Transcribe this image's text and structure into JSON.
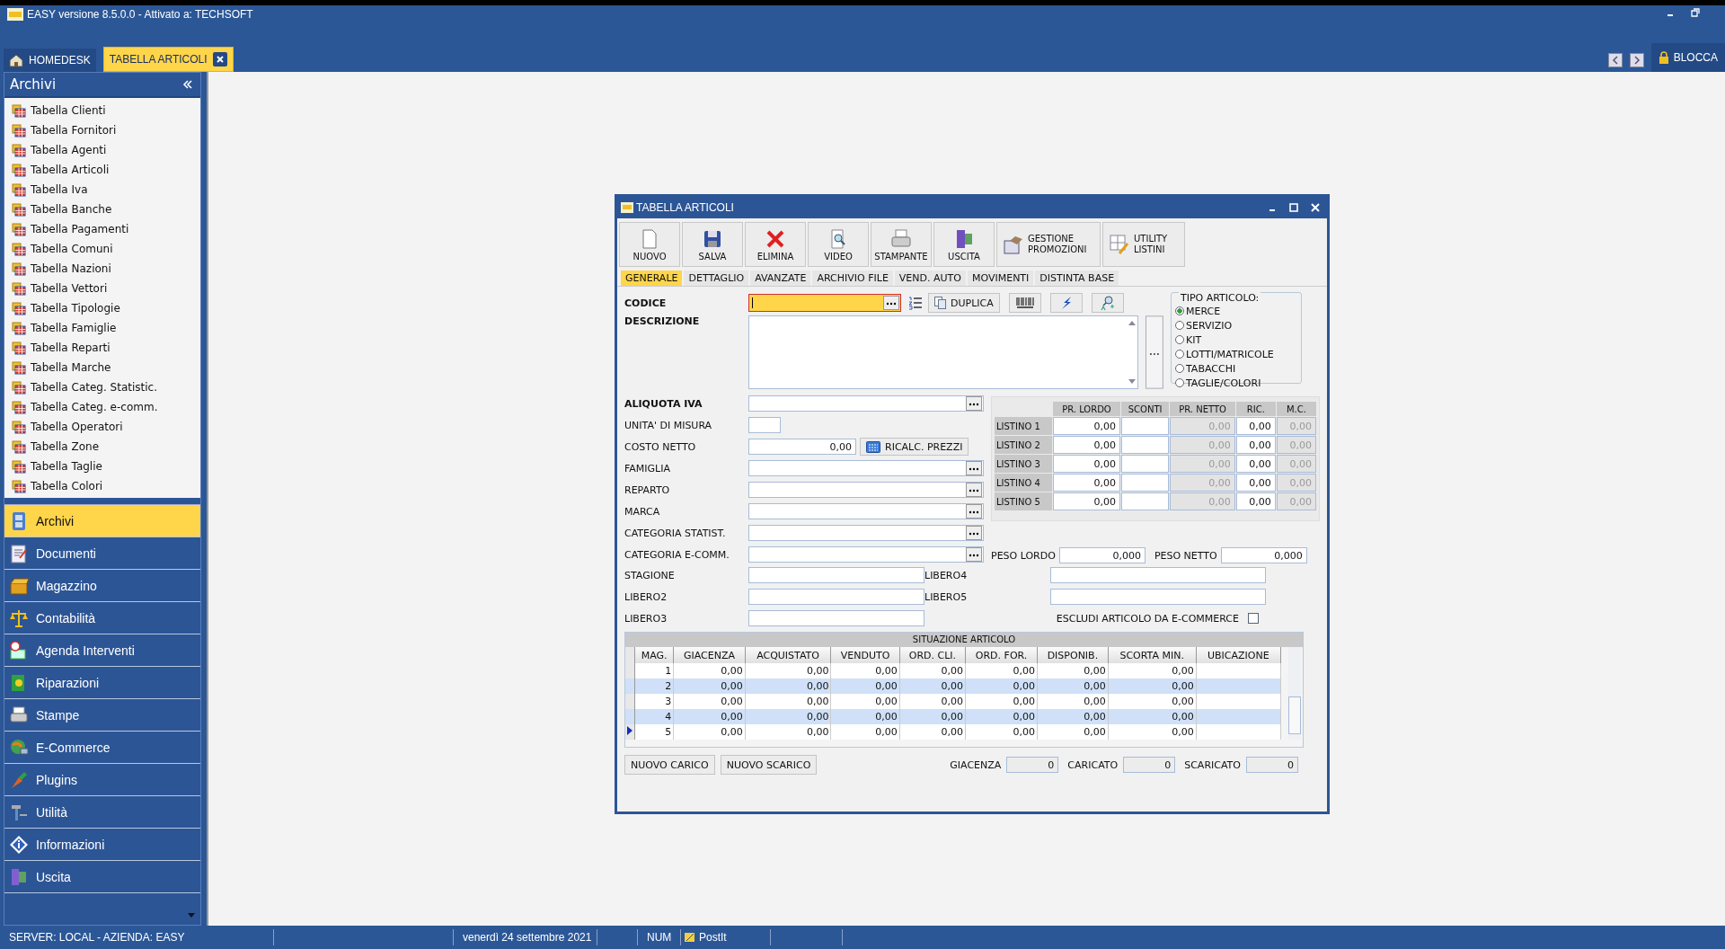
{
  "app": {
    "title": "EASY versione 8.5.0.0 - Attivato a: TECHSOFT"
  },
  "tabs": [
    {
      "label": "HOMEDESK",
      "selected": false
    },
    {
      "label": "TABELLA ARTICOLI",
      "selected": true
    }
  ],
  "lock_button": {
    "label": "BLOCCA"
  },
  "sidebar": {
    "title": "Archivi",
    "items": [
      "Tabella Clienti",
      "Tabella Fornitori",
      "Tabella Agenti",
      "Tabella Articoli",
      "Tabella Iva",
      "Tabella Banche",
      "Tabella Pagamenti",
      "Tabella Comuni",
      "Tabella Nazioni",
      "Tabella Vettori",
      "Tabella Tipologie",
      "Tabella Famiglie",
      "Tabella Reparti",
      "Tabella Marche",
      "Tabella Categ. Statistic.",
      "Tabella Categ. e-comm.",
      "Tabella Operatori",
      "Tabella Zone",
      "Tabella Taglie",
      "Tabella Colori"
    ],
    "nav": [
      {
        "label": "Archivi",
        "kind": "archive",
        "selected": true
      },
      {
        "label": "Documenti",
        "kind": "documents",
        "selected": false
      },
      {
        "label": "Magazzino",
        "kind": "warehouse",
        "selected": false
      },
      {
        "label": "Contabilità",
        "kind": "accounting",
        "selected": false
      },
      {
        "label": "Agenda Interventi",
        "kind": "agenda",
        "selected": false
      },
      {
        "label": "Riparazioni",
        "kind": "repairs",
        "selected": false
      },
      {
        "label": "Stampe",
        "kind": "print",
        "selected": false
      },
      {
        "label": "E-Commerce",
        "kind": "ecommerce",
        "selected": false
      },
      {
        "label": "Plugins",
        "kind": "plugins",
        "selected": false
      },
      {
        "label": "Utilità",
        "kind": "utility",
        "selected": false
      },
      {
        "label": "Informazioni",
        "kind": "info",
        "selected": false
      },
      {
        "label": "Uscita",
        "kind": "exit",
        "selected": false
      }
    ]
  },
  "dialog": {
    "title": "TABELLA ARTICOLI",
    "toolbar": [
      {
        "label": "NUOVO",
        "kind": "new"
      },
      {
        "label": "SALVA",
        "kind": "save"
      },
      {
        "label": "ELIMINA",
        "kind": "delete"
      },
      {
        "label": "VIDEO",
        "kind": "view"
      },
      {
        "label": "STAMPANTE",
        "kind": "print"
      },
      {
        "label": "USCITA",
        "kind": "exit"
      },
      {
        "label": "GESTIONE PROMOZIONI",
        "kind": "promotions"
      },
      {
        "label": "UTILITY LISTINI",
        "kind": "pricelists"
      }
    ],
    "tabs": [
      {
        "label": "GENERALE",
        "selected": true
      },
      {
        "label": "DETTAGLIO",
        "selected": false
      },
      {
        "label": "AVANZATE",
        "selected": false
      },
      {
        "label": "ARCHIVIO FILE",
        "selected": false
      },
      {
        "label": "VEND. AUTO",
        "selected": false
      },
      {
        "label": "MOVIMENTI",
        "selected": false
      },
      {
        "label": "DISTINTA BASE",
        "selected": false
      }
    ],
    "codice": {
      "label": "CODICE",
      "focused": true
    },
    "duplica": {
      "label": "DUPLICA"
    },
    "descrizione": {
      "label": "DESCRIZIONE"
    },
    "tipo_articolo": {
      "title": "TIPO ARTICOLO:",
      "options": [
        {
          "label": "MERCE",
          "selected": true
        },
        {
          "label": "SERVIZIO",
          "selected": false
        },
        {
          "label": "KIT",
          "selected": false
        },
        {
          "label": "LOTTI/MATRICOLE",
          "selected": false
        },
        {
          "label": "TABACCHI",
          "selected": false
        },
        {
          "label": "TAGLIE/COLORI",
          "selected": false
        }
      ]
    },
    "fields": [
      {
        "label": "ALIQUOTA IVA",
        "bold": true,
        "kind": "lookup"
      },
      {
        "label": "UNITA' DI MISURA",
        "bold": false,
        "kind": "short"
      },
      {
        "label": "COSTO NETTO",
        "bold": false,
        "kind": "amount",
        "value": "0,00",
        "button": "RICALC. PREZZI"
      },
      {
        "label": "FAMIGLIA",
        "bold": false,
        "kind": "lookup"
      },
      {
        "label": "REPARTO",
        "bold": false,
        "kind": "lookup"
      },
      {
        "label": "MARCA",
        "bold": false,
        "kind": "lookup"
      },
      {
        "label": "CATEGORIA STATIST.",
        "bold": false,
        "kind": "lookup"
      },
      {
        "label": "CATEGORIA E-COMM.",
        "bold": false,
        "kind": "lookup"
      }
    ],
    "listini": {
      "columns": [
        {
          "label": "PR. LORDO",
          "disabled": false
        },
        {
          "label": "SCONTI",
          "disabled": false
        },
        {
          "label": "PR. NETTO",
          "disabled": true
        },
        {
          "label": "RIC.",
          "disabled": false
        },
        {
          "label": "M.C.",
          "disabled": true
        }
      ],
      "rows": [
        {
          "name": "LISTINO 1",
          "pr_lordo": "0,00",
          "pr_netto": "0,00",
          "ric": "0,00",
          "mc": "0,00"
        },
        {
          "name": "LISTINO 2",
          "pr_lordo": "0,00",
          "pr_netto": "0,00",
          "ric": "0,00",
          "mc": "0,00"
        },
        {
          "name": "LISTINO 3",
          "pr_lordo": "0,00",
          "pr_netto": "0,00",
          "ric": "0,00",
          "mc": "0,00"
        },
        {
          "name": "LISTINO 4",
          "pr_lordo": "0,00",
          "pr_netto": "0,00",
          "ric": "0,00",
          "mc": "0,00"
        },
        {
          "name": "LISTINO 5",
          "pr_lordo": "0,00",
          "pr_netto": "0,00",
          "ric": "0,00",
          "mc": "0,00"
        }
      ]
    },
    "peso": [
      {
        "label": "PESO LORDO",
        "value": "0,000"
      },
      {
        "label": "PESO NETTO",
        "value": "0,000"
      }
    ],
    "extra_left": [
      {
        "label": "STAGIONE"
      },
      {
        "label": "LIBERO2"
      },
      {
        "label": "LIBERO3"
      }
    ],
    "extra_right": [
      {
        "label": "LIBERO4"
      },
      {
        "label": "LIBERO5"
      }
    ],
    "escludi": {
      "label": "ESCLUDI ARTICOLO DA E-COMMERCE",
      "checked": false
    },
    "situazione": {
      "title": "SITUAZIONE ARTICOLO",
      "columns": [
        "MAG.",
        "GIACENZA",
        "ACQUISTATO",
        "VENDUTO",
        "ORD. CLI.",
        "ORD. FOR.",
        "DISPONIB.",
        "SCORTA MIN.",
        "UBICAZIONE"
      ],
      "rows": [
        {
          "cells": [
            "1",
            "0,00",
            "0,00",
            "0,00",
            "0,00",
            "0,00",
            "0,00",
            "0,00"
          ],
          "selected": false
        },
        {
          "cells": [
            "2",
            "0,00",
            "0,00",
            "0,00",
            "0,00",
            "0,00",
            "0,00",
            "0,00"
          ],
          "selected": false
        },
        {
          "cells": [
            "3",
            "0,00",
            "0,00",
            "0,00",
            "0,00",
            "0,00",
            "0,00",
            "0,00"
          ],
          "selected": false
        },
        {
          "cells": [
            "4",
            "0,00",
            "0,00",
            "0,00",
            "0,00",
            "0,00",
            "0,00",
            "0,00"
          ],
          "selected": false
        },
        {
          "cells": [
            "5",
            "0,00",
            "0,00",
            "0,00",
            "0,00",
            "0,00",
            "0,00",
            "0,00"
          ],
          "selected": true
        }
      ]
    },
    "buttons": [
      {
        "label": "NUOVO CARICO"
      },
      {
        "label": "NUOVO SCARICO"
      }
    ],
    "totals": [
      {
        "label": "GIACENZA",
        "value": "0"
      },
      {
        "label": "CARICATO",
        "value": "0"
      },
      {
        "label": "SCARICATO",
        "value": "0"
      }
    ]
  },
  "status_bar": {
    "server": "SERVER: LOCAL - AZIENDA: EASY",
    "date": "venerdì 24 settembre 2021",
    "num": "NUM",
    "postit": "PostIt"
  }
}
